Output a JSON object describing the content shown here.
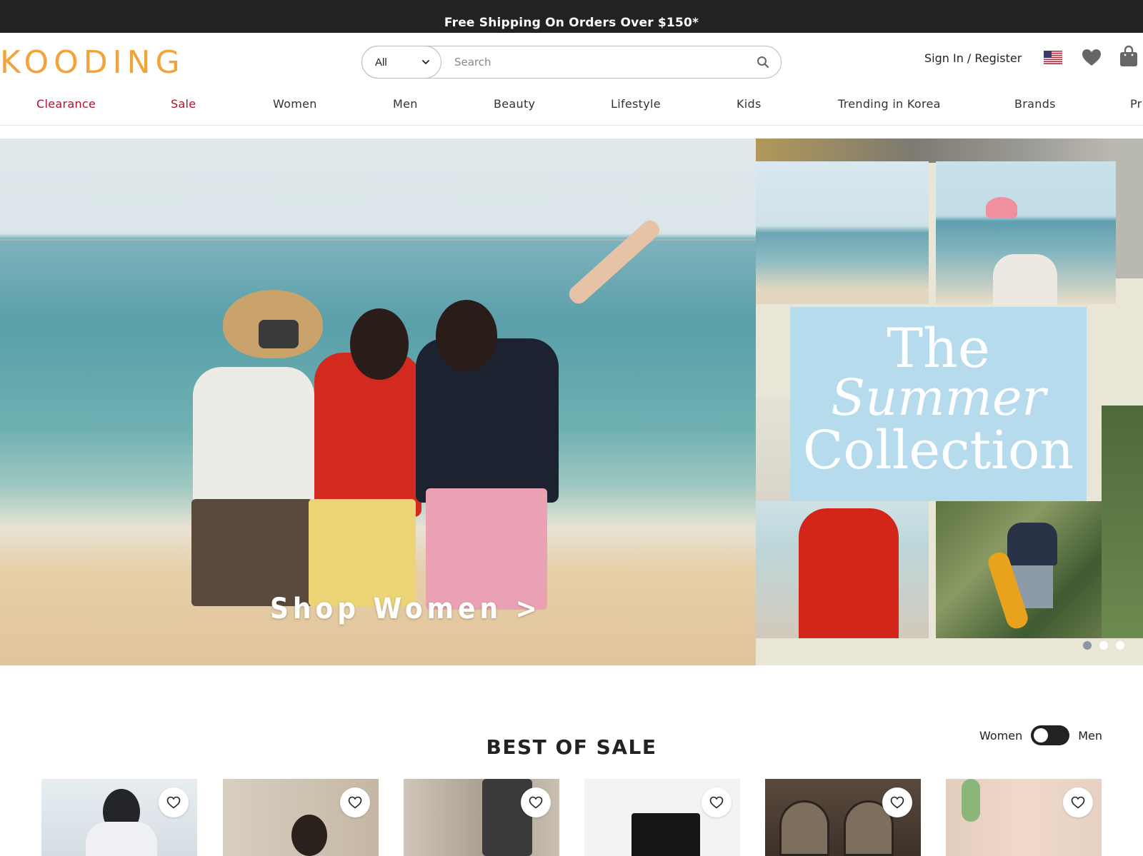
{
  "promo": {
    "text": "Free Shipping On Orders Over $150*"
  },
  "header": {
    "logo": "KOODING",
    "search": {
      "category": "All",
      "placeholder": "Search"
    },
    "signin": "Sign In / Register",
    "icons": [
      "us-flag-icon",
      "heart-icon",
      "shopping-bag-icon"
    ]
  },
  "nav": {
    "items": [
      {
        "label": "Clearance",
        "highlight": true
      },
      {
        "label": "Sale",
        "highlight": true
      },
      {
        "label": "Women",
        "highlight": false
      },
      {
        "label": "Men",
        "highlight": false
      },
      {
        "label": "Beauty",
        "highlight": false
      },
      {
        "label": "Lifestyle",
        "highlight": false
      },
      {
        "label": "Kids",
        "highlight": false
      },
      {
        "label": "Trending in Korea",
        "highlight": false
      },
      {
        "label": "Brands",
        "highlight": false
      },
      {
        "label": "Pr",
        "highlight": false
      }
    ]
  },
  "hero": {
    "cta": "Shop Women >",
    "collection": {
      "line1": "The",
      "line2": "Summer",
      "line3": "Collection"
    },
    "slides": 3,
    "active_slide": 1
  },
  "best_of_sale": {
    "title": "BEST OF SALE",
    "toggle": {
      "left": "Women",
      "right": "Men",
      "selected": "Women"
    },
    "products": 6
  },
  "colors": {
    "accent": "#f2a43a",
    "sale_red": "#b0122b",
    "promo_bg": "#222222",
    "summer_box": "#b6dbec"
  }
}
